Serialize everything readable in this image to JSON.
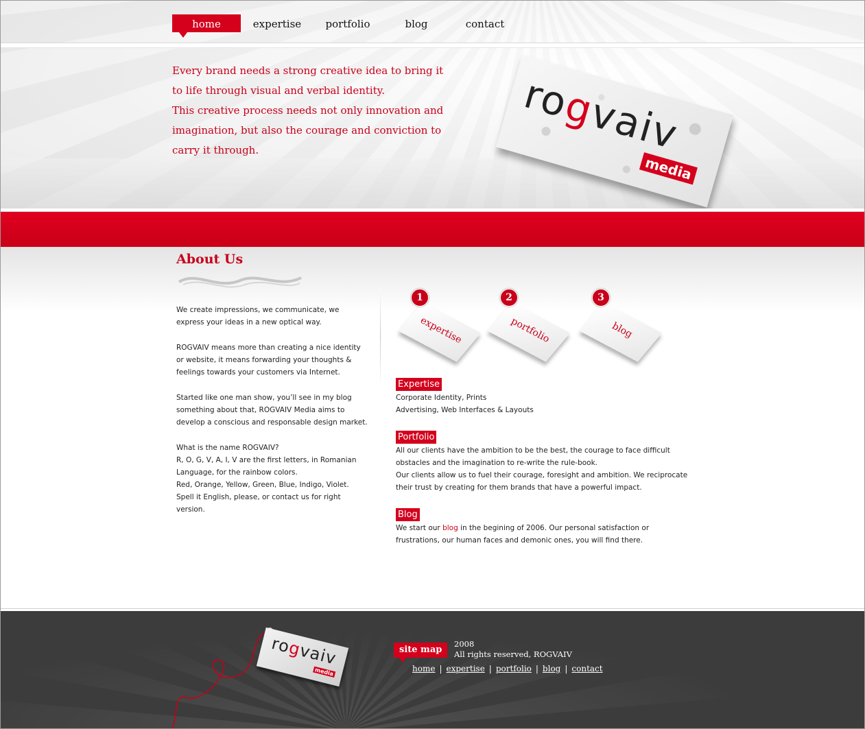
{
  "nav": {
    "items": [
      {
        "label": "home",
        "active": true
      },
      {
        "label": "expertise"
      },
      {
        "label": "portfolio"
      },
      {
        "label": "blog"
      },
      {
        "label": "contact"
      }
    ]
  },
  "hero": {
    "line1": "Every brand needs a strong creative idea to bring it to life through visual and verbal identity.",
    "line2": "This creative process needs not only innovation and imagination, but also the courage and conviction to carry it through."
  },
  "logo": {
    "text_pre": "ro",
    "text_g": "g",
    "text_post": "vaiv",
    "badge": "media"
  },
  "about": {
    "title": "About Us",
    "p1": "We create impressions, we communicate, we express your ideas in a new optical way.",
    "p2": "ROGVAIV means more than creating a nice identity or website, it means forwarding your thoughts & feelings towards your customers via Internet.",
    "p3": "Started like one man show, you’ll see in my blog something about that, ROGVAIV Media aims to develop a conscious and responsable design market.",
    "p4_l1": "What is the name ROGVAIV?",
    "p4_l2": "R, O, G, V, A, I, V are the first letters, in Romanian Language, for the rainbow colors.",
    "p4_l3": "Red, Orange, Yellow, Green, Blue, Indigo, Violet.",
    "p4_l4": "Spell it English, please, or contact us for right version."
  },
  "steps": [
    {
      "num": "1",
      "label": "expertise"
    },
    {
      "num": "2",
      "label": "portfolio"
    },
    {
      "num": "3",
      "label": "blog"
    }
  ],
  "sections": {
    "expertise": {
      "label": "Expertise",
      "l1": "Corporate Identity, Prints",
      "l2": "Advertising, Web Interfaces & Layouts"
    },
    "portfolio": {
      "label": "Portfolio",
      "l1": "All our clients have the ambition to be the best, the courage to face difficult obstacles and the imagination to re-write the rule-book.",
      "l2": "Our clients allow us to fuel their courage, foresight and ambition. We reciprocate their trust by creating for them brands that have a powerful impact."
    },
    "blog": {
      "label": "Blog",
      "pre": "We start our ",
      "link": "blog",
      "post": " in the begining of 2006. Our personal satisfaction or frustrations, our human faces and demonic ones, you will find there."
    }
  },
  "footer": {
    "sitemap": "site map",
    "year": "2008",
    "rights": "All rights reserved, ROGVAIV",
    "links": [
      "home",
      "expertise",
      "portfolio",
      "blog",
      "contact"
    ],
    "logo_pre": "ro",
    "logo_g": "g",
    "logo_post": "vaiv",
    "logo_badge": "media"
  },
  "colors": {
    "accent": "#d4001c",
    "footer_bg": "#3c3c3c"
  }
}
